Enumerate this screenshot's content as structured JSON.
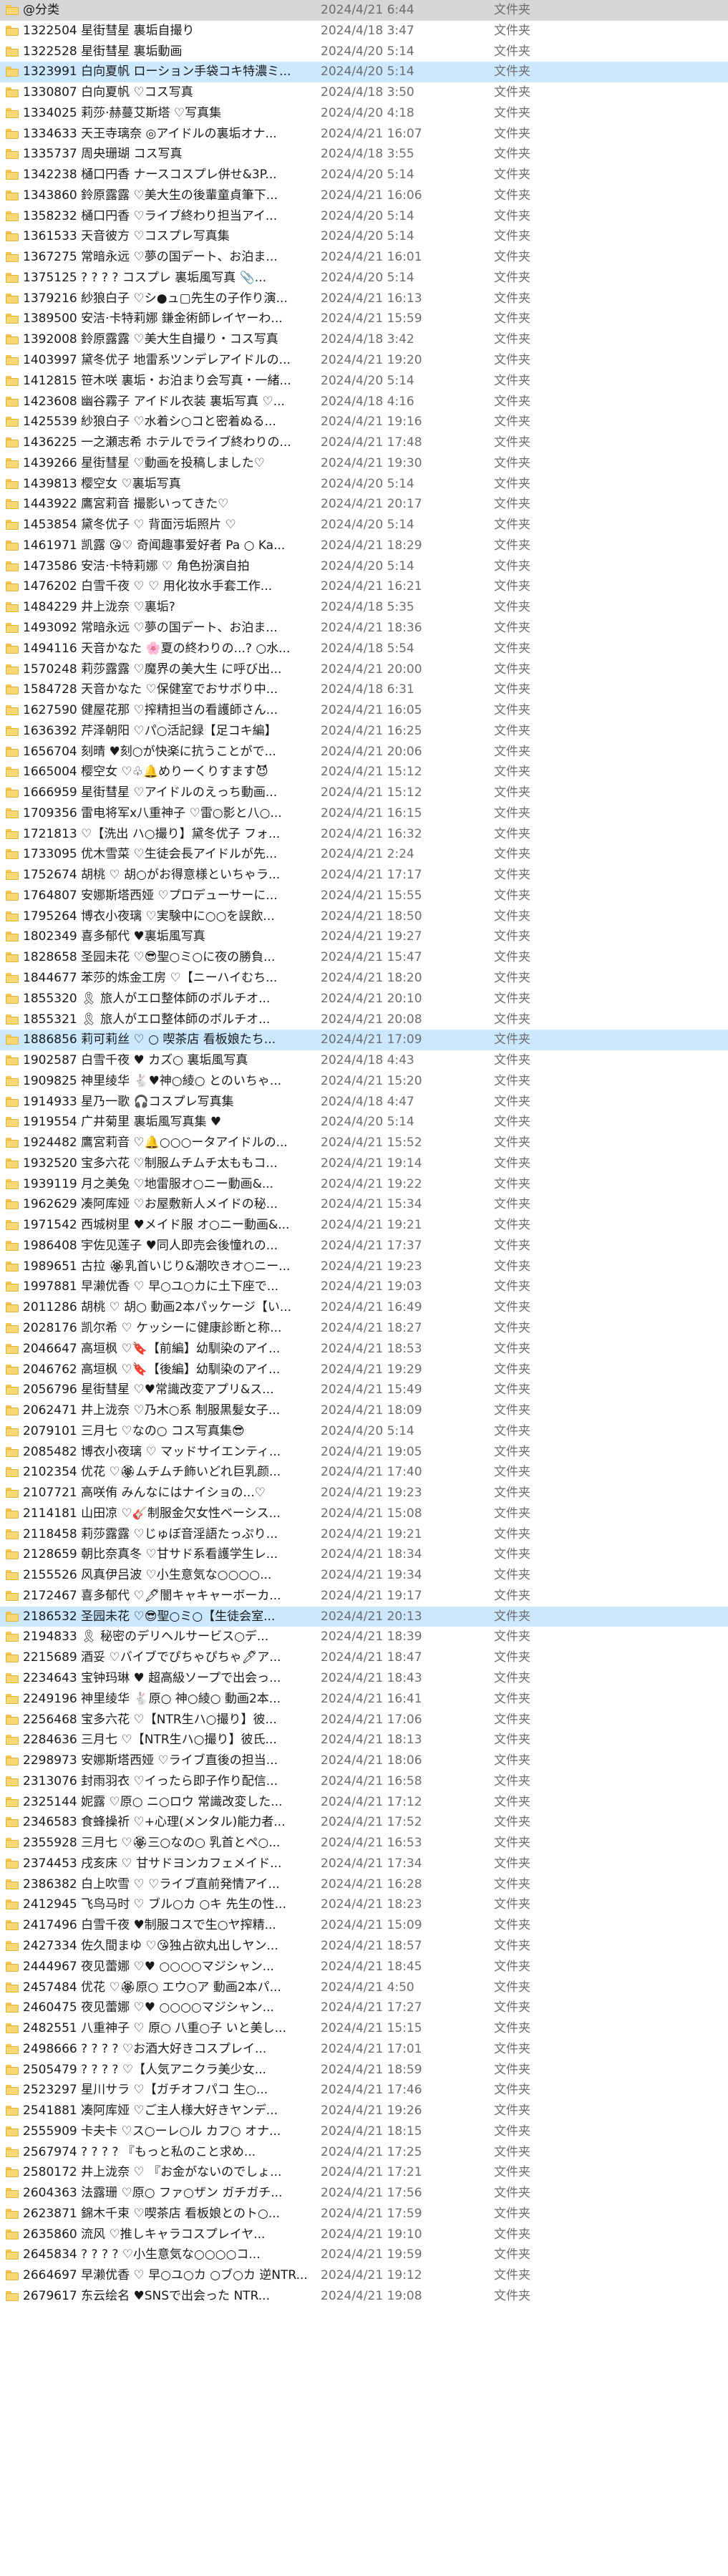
{
  "file_type_label": "文件夹",
  "selected_rows": [
    0,
    3,
    50,
    78
  ],
  "rows": [
    {
      "name": "@分类",
      "date": "2024/4/21 6:44"
    },
    {
      "name": "1322504 星街彗星 裏垢自撮り",
      "date": "2024/4/18 3:47"
    },
    {
      "name": "1322528 星街彗星 裏垢動画",
      "date": "2024/4/20 5:14"
    },
    {
      "name": "1323991 白向夏帆 ローション手袋コキ特濃ミ...",
      "date": "2024/4/20 5:14"
    },
    {
      "name": "1330807 白向夏帆 ♡コス写真",
      "date": "2024/4/18 3:50"
    },
    {
      "name": "1334025 莉莎·赫蔓艾斯塔 ♡写真集",
      "date": "2024/4/20 4:18"
    },
    {
      "name": "1334633 天王寺璃奈 ◎アイドルの裏垢オナ...",
      "date": "2024/4/21 16:07"
    },
    {
      "name": "1335737 周央珊瑚 コス写真",
      "date": "2024/4/18 3:55"
    },
    {
      "name": "1342238 樋口円香 ナースコスプレ併せ&3P...",
      "date": "2024/4/20 5:14"
    },
    {
      "name": "1343860 鈴原露露 ♡美大生の後輩童貞筆下...",
      "date": "2024/4/21 16:06"
    },
    {
      "name": "1358232 樋口円香 ♡ライブ終わり担当アイ...",
      "date": "2024/4/20 5:14"
    },
    {
      "name": "1361533 天音彼方 ♡コスプレ写真集",
      "date": "2024/4/20 5:14"
    },
    {
      "name": "1367275 常暗永远 ♡夢の国デート、お泊ま...",
      "date": "2024/4/21 16:01"
    },
    {
      "name": "1375125 ? ? ? ? コスプレ 裏垢風写真 📎...",
      "date": "2024/4/20 5:14"
    },
    {
      "name": "1379216 紗狼白子 ♡シ●ュ▢先生の子作り演...",
      "date": "2024/4/21 16:13"
    },
    {
      "name": "1389500 安洁·卡特莉娜 鎌金術師レイヤーわ...",
      "date": "2024/4/21 15:59"
    },
    {
      "name": "1392008 鈴原露露 ♡美大生自撮り・コス写真",
      "date": "2024/4/18 3:42"
    },
    {
      "name": "1403997 黛冬优子 地雷系ツンデレアイドルの...",
      "date": "2024/4/21 19:20"
    },
    {
      "name": "1412815 笹木咲 裏垢・お泊まり会写真・一緒...",
      "date": "2024/4/20 5:14"
    },
    {
      "name": "1423608 幽谷霧子 アイドル衣装 裏垢写真 ♡...",
      "date": "2024/4/18 4:16"
    },
    {
      "name": "1425539 紗狼白子 ♡水着シ○コと密着ぬる...",
      "date": "2024/4/21 19:16"
    },
    {
      "name": "1436225 一之瀬志希 ホテルでライブ終わりの...",
      "date": "2024/4/21 17:48"
    },
    {
      "name": "1439266 星街彗星 ♡動画を投稿しました♡",
      "date": "2024/4/21 19:30"
    },
    {
      "name": "1439813 樱空女 ♡裏垢写真",
      "date": "2024/4/20 5:14"
    },
    {
      "name": "1443922 鷹宮莉音 撮影いってきた♡",
      "date": "2024/4/21 20:17"
    },
    {
      "name": "1453854 黛冬优子 ♡ 背面污垢照片 ♡",
      "date": "2024/4/20 5:14"
    },
    {
      "name": "1461971 凯露 😘♡ 奇闻趣事爱好者 Pa ○ Ka...",
      "date": "2024/4/21 18:29"
    },
    {
      "name": "1473586 安洁·卡特莉娜 ♡ 角色扮演自拍",
      "date": "2024/4/20 5:14"
    },
    {
      "name": "1476202 白雪千夜 ♡ ♡ 用化妆水手套工作...",
      "date": "2024/4/21 16:21"
    },
    {
      "name": "1484229 井上泷奈 ♡裏垢?",
      "date": "2024/4/18 5:35"
    },
    {
      "name": "1493092 常暗永远 ♡夢の国デート、お泊ま...",
      "date": "2024/4/21 18:36"
    },
    {
      "name": "1494116 天音かなた 🌸夏の終わりの...? ○水...",
      "date": "2024/4/18 5:54"
    },
    {
      "name": "1570248 莉莎露露 ♡魔界の美大生 に呼び出...",
      "date": "2024/4/21 20:00"
    },
    {
      "name": "1584728 天音かなた ♡保健室でおサボり中...",
      "date": "2024/4/18 6:31"
    },
    {
      "name": "1627590 健屋花那 ♡搾精担当の看護師さん...",
      "date": "2024/4/21 16:05"
    },
    {
      "name": "1636392 芹泽朝阳 ♡パ○活記録【足コキ編】",
      "date": "2024/4/21 16:25"
    },
    {
      "name": "1656704 刻晴 ♥刻○が快楽に抗うことがで...",
      "date": "2024/4/21 20:06"
    },
    {
      "name": "1665004 樱空女 ♡♧🔔めりーくりすます😈",
      "date": "2024/4/21 15:12"
    },
    {
      "name": "1666959 星街彗星 ♡アイドルのえっち動画...",
      "date": "2024/4/21 15:12"
    },
    {
      "name": "1709356 雷电将军x八重神子 ♡雷○影と八○...",
      "date": "2024/4/21 16:15"
    },
    {
      "name": "1721813 ♡【洗出 ハ○撮り】黛冬优子 フォ...",
      "date": "2024/4/21 16:32"
    },
    {
      "name": "1733095 优木雪菜 ♡生徒会長アイドルが先...",
      "date": "2024/4/21 2:24"
    },
    {
      "name": "1752674 胡桃 ♡ 胡○がお得意様といちゃラ...",
      "date": "2024/4/21 17:17"
    },
    {
      "name": "1764807 安娜斯塔西娅 ♡プロデューサーに...",
      "date": "2024/4/21 15:55"
    },
    {
      "name": "1795264 博衣小夜璃 ♡実験中に○○を誤飲...",
      "date": "2024/4/21 18:50"
    },
    {
      "name": "1802349 喜多郁代 ♥裏垢風写真",
      "date": "2024/4/21 19:27"
    },
    {
      "name": "1828658 圣园未花 ♡😎聖○ミ○に夜の勝負...",
      "date": "2024/4/21 15:47"
    },
    {
      "name": "1844677 苯莎的炼金工房 ♡【ニーハイむち...",
      "date": "2024/4/21 18:20"
    },
    {
      "name": "1855320 🎗 旅人がエロ整体師のボルチオ...",
      "date": "2024/4/21 20:10"
    },
    {
      "name": "1855321 🎗 旅人がエロ整体師のボルチオ...",
      "date": "2024/4/21 20:08"
    },
    {
      "name": "1886856 莉可莉丝 ♡ ○ 喫茶店 看板娘たち...",
      "date": "2024/4/21 17:09"
    },
    {
      "name": "1902587 白雪千夜 ♥ カズ○ 裏垢風写真",
      "date": "2024/4/18 4:43"
    },
    {
      "name": "1909825 神里绫华 🐇♥神○綾○ とのいちゃ...",
      "date": "2024/4/21 15:20"
    },
    {
      "name": "1914933 星乃一歌 🎧コスプレ写真集",
      "date": "2024/4/18 4:47"
    },
    {
      "name": "1919554 广井菊里 裏垢風写真集 ♥",
      "date": "2024/4/20 5:14"
    },
    {
      "name": "1924482 鷹宮莉音 ♡🔔○○○ータアイドルの...",
      "date": "2024/4/21 15:52"
    },
    {
      "name": "1932520 宝多六花 ♡制服ムチムチ太ももコ...",
      "date": "2024/4/21 19:14"
    },
    {
      "name": "1939119 月之美兔 ♡地雷服オ○ニー動画&...",
      "date": "2024/4/21 19:22"
    },
    {
      "name": "1962629 凑阿库娅 ♡お屋敷新人メイドの秘...",
      "date": "2024/4/21 15:34"
    },
    {
      "name": "1971542 西城树里 ♥メイド服 オ○ニー動画&...",
      "date": "2024/4/21 19:21"
    },
    {
      "name": "1986408 宇佐见莲子 ♥同人即売会後憧れの...",
      "date": "2024/4/21 17:37"
    },
    {
      "name": "1989651 古拉 🏵乳首いじり&潮吹きオ○ニー...",
      "date": "2024/4/21 19:23"
    },
    {
      "name": "1997881 早濑优香 ♡ 早○ユ○カに土下座で...",
      "date": "2024/4/21 19:03"
    },
    {
      "name": "2011286 胡桃 ♡ 胡○ 動画2本パッケージ【い...",
      "date": "2024/4/21 16:49"
    },
    {
      "name": "2028176 凯尔希 ♡ ケッシーに健康診断と称...",
      "date": "2024/4/21 18:27"
    },
    {
      "name": "2046647 高垣枫 ♡🔖【前編】幼馴染のアイ...",
      "date": "2024/4/21 18:53"
    },
    {
      "name": "2046762 高垣枫 ♡🔖【後編】幼馴染のアイ...",
      "date": "2024/4/21 19:29"
    },
    {
      "name": "2056796 星街彗星 ♡♥常識改変アプリ&ス...",
      "date": "2024/4/21 15:49"
    },
    {
      "name": "2062471 井上泷奈 ♡乃木○系 制服黒髪女子...",
      "date": "2024/4/21 18:09"
    },
    {
      "name": "2079101 三月七 ♡なの○ コス写真集😎",
      "date": "2024/4/20 5:14"
    },
    {
      "name": "2085482 博衣小夜璃 ♡ マッドサイエンティ...",
      "date": "2024/4/21 19:05"
    },
    {
      "name": "2102354 优花 ♡🏵ムチムチ飾いどれ巨乳颜...",
      "date": "2024/4/21 17:40"
    },
    {
      "name": "2107721 高咲侑 みんなにはナイショの...♡",
      "date": "2024/4/21 19:23"
    },
    {
      "name": "2114181 山田凉 ♡🎸制服金欠女性ベーシス...",
      "date": "2024/4/21 15:08"
    },
    {
      "name": "2118458 莉莎露露 ♡じゅぼ音淫語たっぷり...",
      "date": "2024/4/21 19:21"
    },
    {
      "name": "2128659 朝比奈真冬 ♡甘サド系看護学生レ...",
      "date": "2024/4/21 18:34"
    },
    {
      "name": "2155526 风真伊吕波 ♡小生意気な○○○○...",
      "date": "2024/4/21 19:34"
    },
    {
      "name": "2172467 喜多郁代 ♡🖊闇キャキャーボーカ...",
      "date": "2024/4/21 19:17"
    },
    {
      "name": "2186532 圣园未花 ♡😎聖○ミ○【生徒会室...",
      "date": "2024/4/21 20:13"
    },
    {
      "name": "2194833 🎗 秘密のデリヘルサービス○デ...",
      "date": "2024/4/21 18:39"
    },
    {
      "name": "2215689 酒妥 ♡バイブでぴちゃぴちゃ🖊ア...",
      "date": "2024/4/21 18:47"
    },
    {
      "name": "2234643 宝钟玛琳 ♥ 超高級ソープで出会っ...",
      "date": "2024/4/21 18:43"
    },
    {
      "name": "2249196 神里绫华 🐇原○ 神○綾○ 動画2本...",
      "date": "2024/4/21 16:41"
    },
    {
      "name": "2256468 宝多六花 ♡【NTR生ハ○撮り】彼...",
      "date": "2024/4/21 17:06"
    },
    {
      "name": "2284636 三月七 ♡【NTR生ハ○撮り】彼氏...",
      "date": "2024/4/21 18:13"
    },
    {
      "name": "2298973 安娜斯塔西娅 ♡ライブ直後の担当...",
      "date": "2024/4/21 18:06"
    },
    {
      "name": "2313076 封雨羽衣 ♡イったら即子作り配信...",
      "date": "2024/4/21 16:58"
    },
    {
      "name": "2325144 妮露 ♡原○ ニ○ロウ 常識改変した...",
      "date": "2024/4/21 17:12"
    },
    {
      "name": "2346583 食蜂操祈 ♡+心理(メンタル)能力者...",
      "date": "2024/4/21 17:52"
    },
    {
      "name": "2355928 三月七 ♡🏵三○なの○ 乳首とペ○...",
      "date": "2024/4/21 16:53"
    },
    {
      "name": "2374453 戌亥床 ♡ 甘サドヨンカフェメイド...",
      "date": "2024/4/21 17:34"
    },
    {
      "name": "2386382 白上吹雪 ♡ ♡ライブ直前発情アイ...",
      "date": "2024/4/21 16:28"
    },
    {
      "name": "2412945 飞鸟马时 ♡ ブル○カ ○キ 先生の性...",
      "date": "2024/4/21 18:23"
    },
    {
      "name": "2417496 白雪千夜 ♥制服コスで生○ヤ搾精...",
      "date": "2024/4/21 15:09"
    },
    {
      "name": "2427334 佐久間まゆ ♡😘独占欲丸出しヤン...",
      "date": "2024/4/21 18:57"
    },
    {
      "name": "2444967 夜见蕾娜 ♡♥ ○○○○マジシャン...",
      "date": "2024/4/21 18:45"
    },
    {
      "name": "2457484 优花 ♡🏵原○ エウ○ア 動画2本パ...",
      "date": "2024/4/21 4:50"
    },
    {
      "name": "2460475 夜见蕾娜 ♡♥ ○○○○マジシャン...",
      "date": "2024/4/21 17:27"
    },
    {
      "name": "2482551 八重神子 ♡ 原○ 八重○子 いと美し...",
      "date": "2024/4/21 15:15"
    },
    {
      "name": "2498666 ? ? ? ? ♡お酒大好きコスプレイ...",
      "date": "2024/4/21 17:01"
    },
    {
      "name": "2505479 ? ? ? ? ♡【人気アニクラ美少女...",
      "date": "2024/4/21 18:59"
    },
    {
      "name": "2523297 星川サラ ♡【ガチオフパコ 生○...",
      "date": "2024/4/21 17:46"
    },
    {
      "name": "2541881 凑阿库娅 ♡ご主人様大好きヤンデ...",
      "date": "2024/4/21 19:26"
    },
    {
      "name": "2555909 卡夫卡 ♡ス○ーレ○ル カフ○ オナ...",
      "date": "2024/4/21 18:15"
    },
    {
      "name": "2567974 ? ? ? ? 『もっと私のこと求め...",
      "date": "2024/4/21 17:25"
    },
    {
      "name": "2580172 井上泷奈 ♡ 『お金がないのでしょ...",
      "date": "2024/4/21 17:21"
    },
    {
      "name": "2604363 法露珊 ♡原○ ファ○ザン ガチガチ...",
      "date": "2024/4/21 17:56"
    },
    {
      "name": "2623871 錦木千束 ♡喫茶店 看板娘とのト○...",
      "date": "2024/4/21 17:59"
    },
    {
      "name": "2635860 流风 ♡推しキャラコスプレイヤ...",
      "date": "2024/4/21 19:10"
    },
    {
      "name": "2645834 ? ? ? ? ♡小生意気な○○○○コ...",
      "date": "2024/4/21 19:59"
    },
    {
      "name": "2664697 早濑优香 ♡ 早○ユ○カ ○ブ○カ 逆NTR...",
      "date": "2024/4/21 19:12"
    },
    {
      "name": "2679617 东云绘名 ♥SNSで出会った NTR...",
      "date": "2024/4/21 19:08"
    }
  ]
}
